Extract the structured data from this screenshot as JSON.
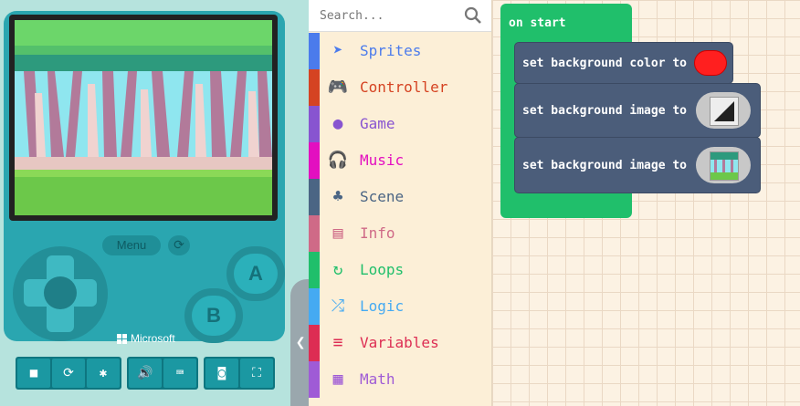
{
  "simulator": {
    "menu_label": "Menu",
    "button_a": "A",
    "button_b": "B",
    "brand": "Microsoft",
    "toolbar_icons": [
      "stop-icon",
      "restart-icon",
      "debug-icon",
      "mute-icon",
      "keyboard-icon",
      "screenshot-icon",
      "fullscreen-icon"
    ]
  },
  "toolbox": {
    "search_placeholder": "Search...",
    "categories": [
      {
        "label": "Sprites",
        "icon": "paper-plane-icon",
        "color": "#4b7bec"
      },
      {
        "label": "Controller",
        "icon": "gamepad-icon",
        "color": "#d54322"
      },
      {
        "label": "Game",
        "icon": "circle-icon",
        "color": "#8854d0"
      },
      {
        "label": "Music",
        "icon": "headphones-icon",
        "color": "#e30fc0"
      },
      {
        "label": "Scene",
        "icon": "tree-icon",
        "color": "#4b6584"
      },
      {
        "label": "Info",
        "icon": "id-card-icon",
        "color": "#cf6a87"
      },
      {
        "label": "Loops",
        "icon": "refresh-icon",
        "color": "#20bf6b"
      },
      {
        "label": "Logic",
        "icon": "shuffle-icon",
        "color": "#45aaf2"
      },
      {
        "label": "Variables",
        "icon": "list-icon",
        "color": "#dd2d53"
      },
      {
        "label": "Math",
        "icon": "calculator-icon",
        "color": "#9f5bd6"
      }
    ]
  },
  "workspace": {
    "hat_label": "on start",
    "blocks": [
      {
        "text": "set background color to",
        "value_color": "#ff1f1f"
      },
      {
        "text": "set background image to",
        "value": "diagonal-image"
      },
      {
        "text": "set background image to",
        "value": "forest-image"
      }
    ]
  }
}
